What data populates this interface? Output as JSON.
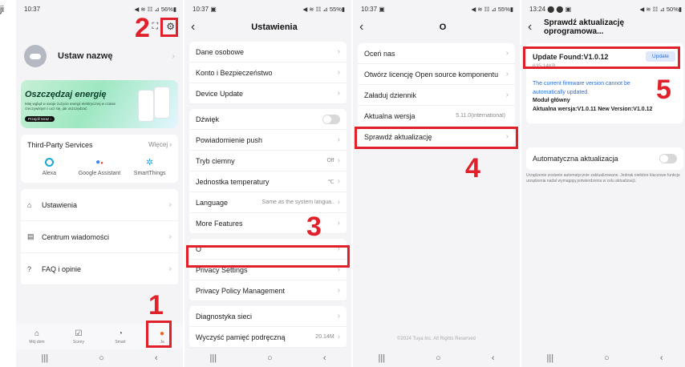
{
  "fragment_text": "ji",
  "annotations": [
    "1",
    "2",
    "3",
    "4",
    "5"
  ],
  "sysnav": {
    "recent": "|||",
    "home": "○",
    "back": "‹"
  },
  "phone1": {
    "status_time": "10:37",
    "status_right": "◀ ≋ ☷ ⊿ 56%▮",
    "profile_name": "Ustaw nazwę",
    "banner_title": "Oszczędzaj energię",
    "banner_sub": "Miej wgląd w swoje zużycie energii elektrycznej w czasie rzeczywistym i ucz się, jak oszczędzać.",
    "banner_button": "Przejdź teraz ›",
    "third_party_title": "Third-Party Services",
    "third_party_more": "Więcej",
    "services": [
      "Alexa",
      "Google Assistant",
      "SmartThings"
    ],
    "menu": [
      "Ustawienia",
      "Centrum wiadomości",
      "FAQ i opinie"
    ],
    "tabs": [
      "Mój dom",
      "Sceny",
      "Smart",
      "Ja"
    ]
  },
  "phone2": {
    "status_time": "10:37 ▣",
    "status_right": "◀ ≋ ☷ ⊿ 55%▮",
    "title": "Ustawienia",
    "group1": [
      "Dane osobowe",
      "Konto i Bezpieczeństwo",
      "Device Update"
    ],
    "group2": [
      {
        "label": "Dźwięk",
        "value": ""
      },
      {
        "label": "Powiadomienie push",
        "value": ""
      },
      {
        "label": "Tryb ciemny",
        "value": "Off"
      },
      {
        "label": "Jednostka temperatury",
        "value": "℃"
      },
      {
        "label": "Language",
        "value": "Same as the system langua..."
      },
      {
        "label": "More Features",
        "value": ""
      }
    ],
    "group3": [
      "O",
      "Privacy Settings",
      "Privacy Policy Management"
    ],
    "group4": [
      {
        "label": "Diagnostyka sieci",
        "value": ""
      },
      {
        "label": "Wyczyść pamięć podręczną",
        "value": "20.14M"
      }
    ]
  },
  "phone3": {
    "status_time": "10:37 ▣",
    "status_right": "◀ ≋ ☷ ⊿ 55%▮",
    "title": "O",
    "items": [
      {
        "label": "Oceń nas",
        "value": ""
      },
      {
        "label": "Otwórz licencję Open source komponentu",
        "value": ""
      },
      {
        "label": "Załaduj dziennik",
        "value": ""
      },
      {
        "label": "Aktualna wersja",
        "value": "5.11.0(international)"
      },
      {
        "label": "Sprawdź aktualizację",
        "value": ""
      }
    ],
    "footer": "©2024 Tuya Inc. All Rights Reserved"
  },
  "phone4": {
    "status_time": "13:24 ⬤ ⬤ ▣",
    "status_right": "◀ ≋ ☷ ⊿ 50%▮",
    "title": "Sprawdź aktualizację oprogramowa...",
    "update_found": "Update Found:V1.0.12",
    "update_button": "Update",
    "size": "635,14KB",
    "info1": "The current firmware version cannot be automatically updated.",
    "module": "Moduł główny",
    "versions": "Aktualna wersja:V1.0.11 New Version:V1.0.12",
    "auto_label": "Automatyczna aktualizacja",
    "auto_note": "Urządzenie zostanie automatycznie zaktualizowane. Jednak niektóre kluczowe funkcje urządzenia nadal wymagają potwierdzenia w celu aktualizacji."
  },
  "colors": {
    "accent_red": "#e0202a",
    "link_blue": "#2a6fd8",
    "active_tab": "#f06020"
  }
}
